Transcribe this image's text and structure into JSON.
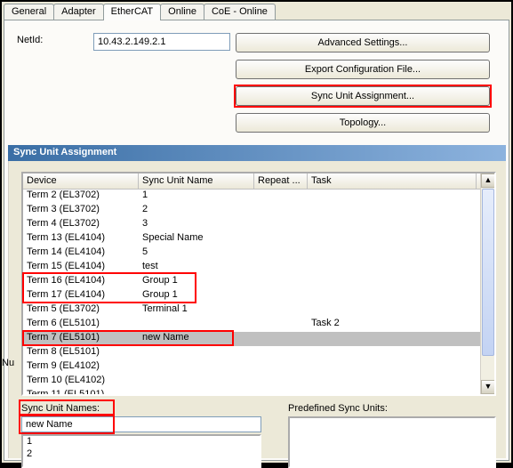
{
  "tabs": [
    "General",
    "Adapter",
    "EtherCAT",
    "Online",
    "CoE - Online"
  ],
  "active_tab": 2,
  "netid_label": "NetId:",
  "netid_value": "10.43.2.149.2.1",
  "buttons": {
    "advanced": "Advanced Settings...",
    "export": "Export Configuration File...",
    "sync": "Sync Unit Assignment...",
    "topology": "Topology..."
  },
  "dialog_title": "Sync Unit Assignment",
  "columns": [
    "Device",
    "Sync Unit Name",
    "Repeat ...",
    "Task"
  ],
  "rows": [
    {
      "dev": "Term 2 (EL3702)",
      "su": "1",
      "rep": "",
      "task": ""
    },
    {
      "dev": "Term 3 (EL3702)",
      "su": "2",
      "rep": "",
      "task": ""
    },
    {
      "dev": "Term 4 (EL3702)",
      "su": "3",
      "rep": "",
      "task": ""
    },
    {
      "dev": "Term 13 (EL4104)",
      "su": "Special Name",
      "rep": "",
      "task": ""
    },
    {
      "dev": "Term 14 (EL4104)",
      "su": "5",
      "rep": "",
      "task": ""
    },
    {
      "dev": "Term 15 (EL4104)",
      "su": "test",
      "rep": "",
      "task": ""
    },
    {
      "dev": "Term 16 (EL4104)",
      "su": "Group 1",
      "rep": "",
      "task": ""
    },
    {
      "dev": "Term 17 (EL4104)",
      "su": "Group 1",
      "rep": "",
      "task": ""
    },
    {
      "dev": "Term 5 (EL3702)",
      "su": "Terminal 1",
      "rep": "",
      "task": ""
    },
    {
      "dev": "Term 6 (EL5101)",
      "su": "",
      "rep": "",
      "task": "Task 2"
    },
    {
      "dev": "Term 7 (EL5101)",
      "su": "new Name",
      "rep": "",
      "task": "",
      "selected": true
    },
    {
      "dev": "Term 8 (EL5101)",
      "su": "",
      "rep": "",
      "task": ""
    },
    {
      "dev": "Term 9 (EL4102)",
      "su": "",
      "rep": "",
      "task": ""
    },
    {
      "dev": "Term 10 (EL4102)",
      "su": "",
      "rep": "",
      "task": ""
    },
    {
      "dev": "Term 11 (EL5101)",
      "su": "",
      "rep": "",
      "task": ""
    }
  ],
  "sync_unit_names_label": "Sync Unit Names:",
  "predefined_label": "Predefined Sync Units:",
  "su_input_value": "new Name",
  "su_list": [
    "1",
    "2"
  ],
  "gutter": "Nu"
}
